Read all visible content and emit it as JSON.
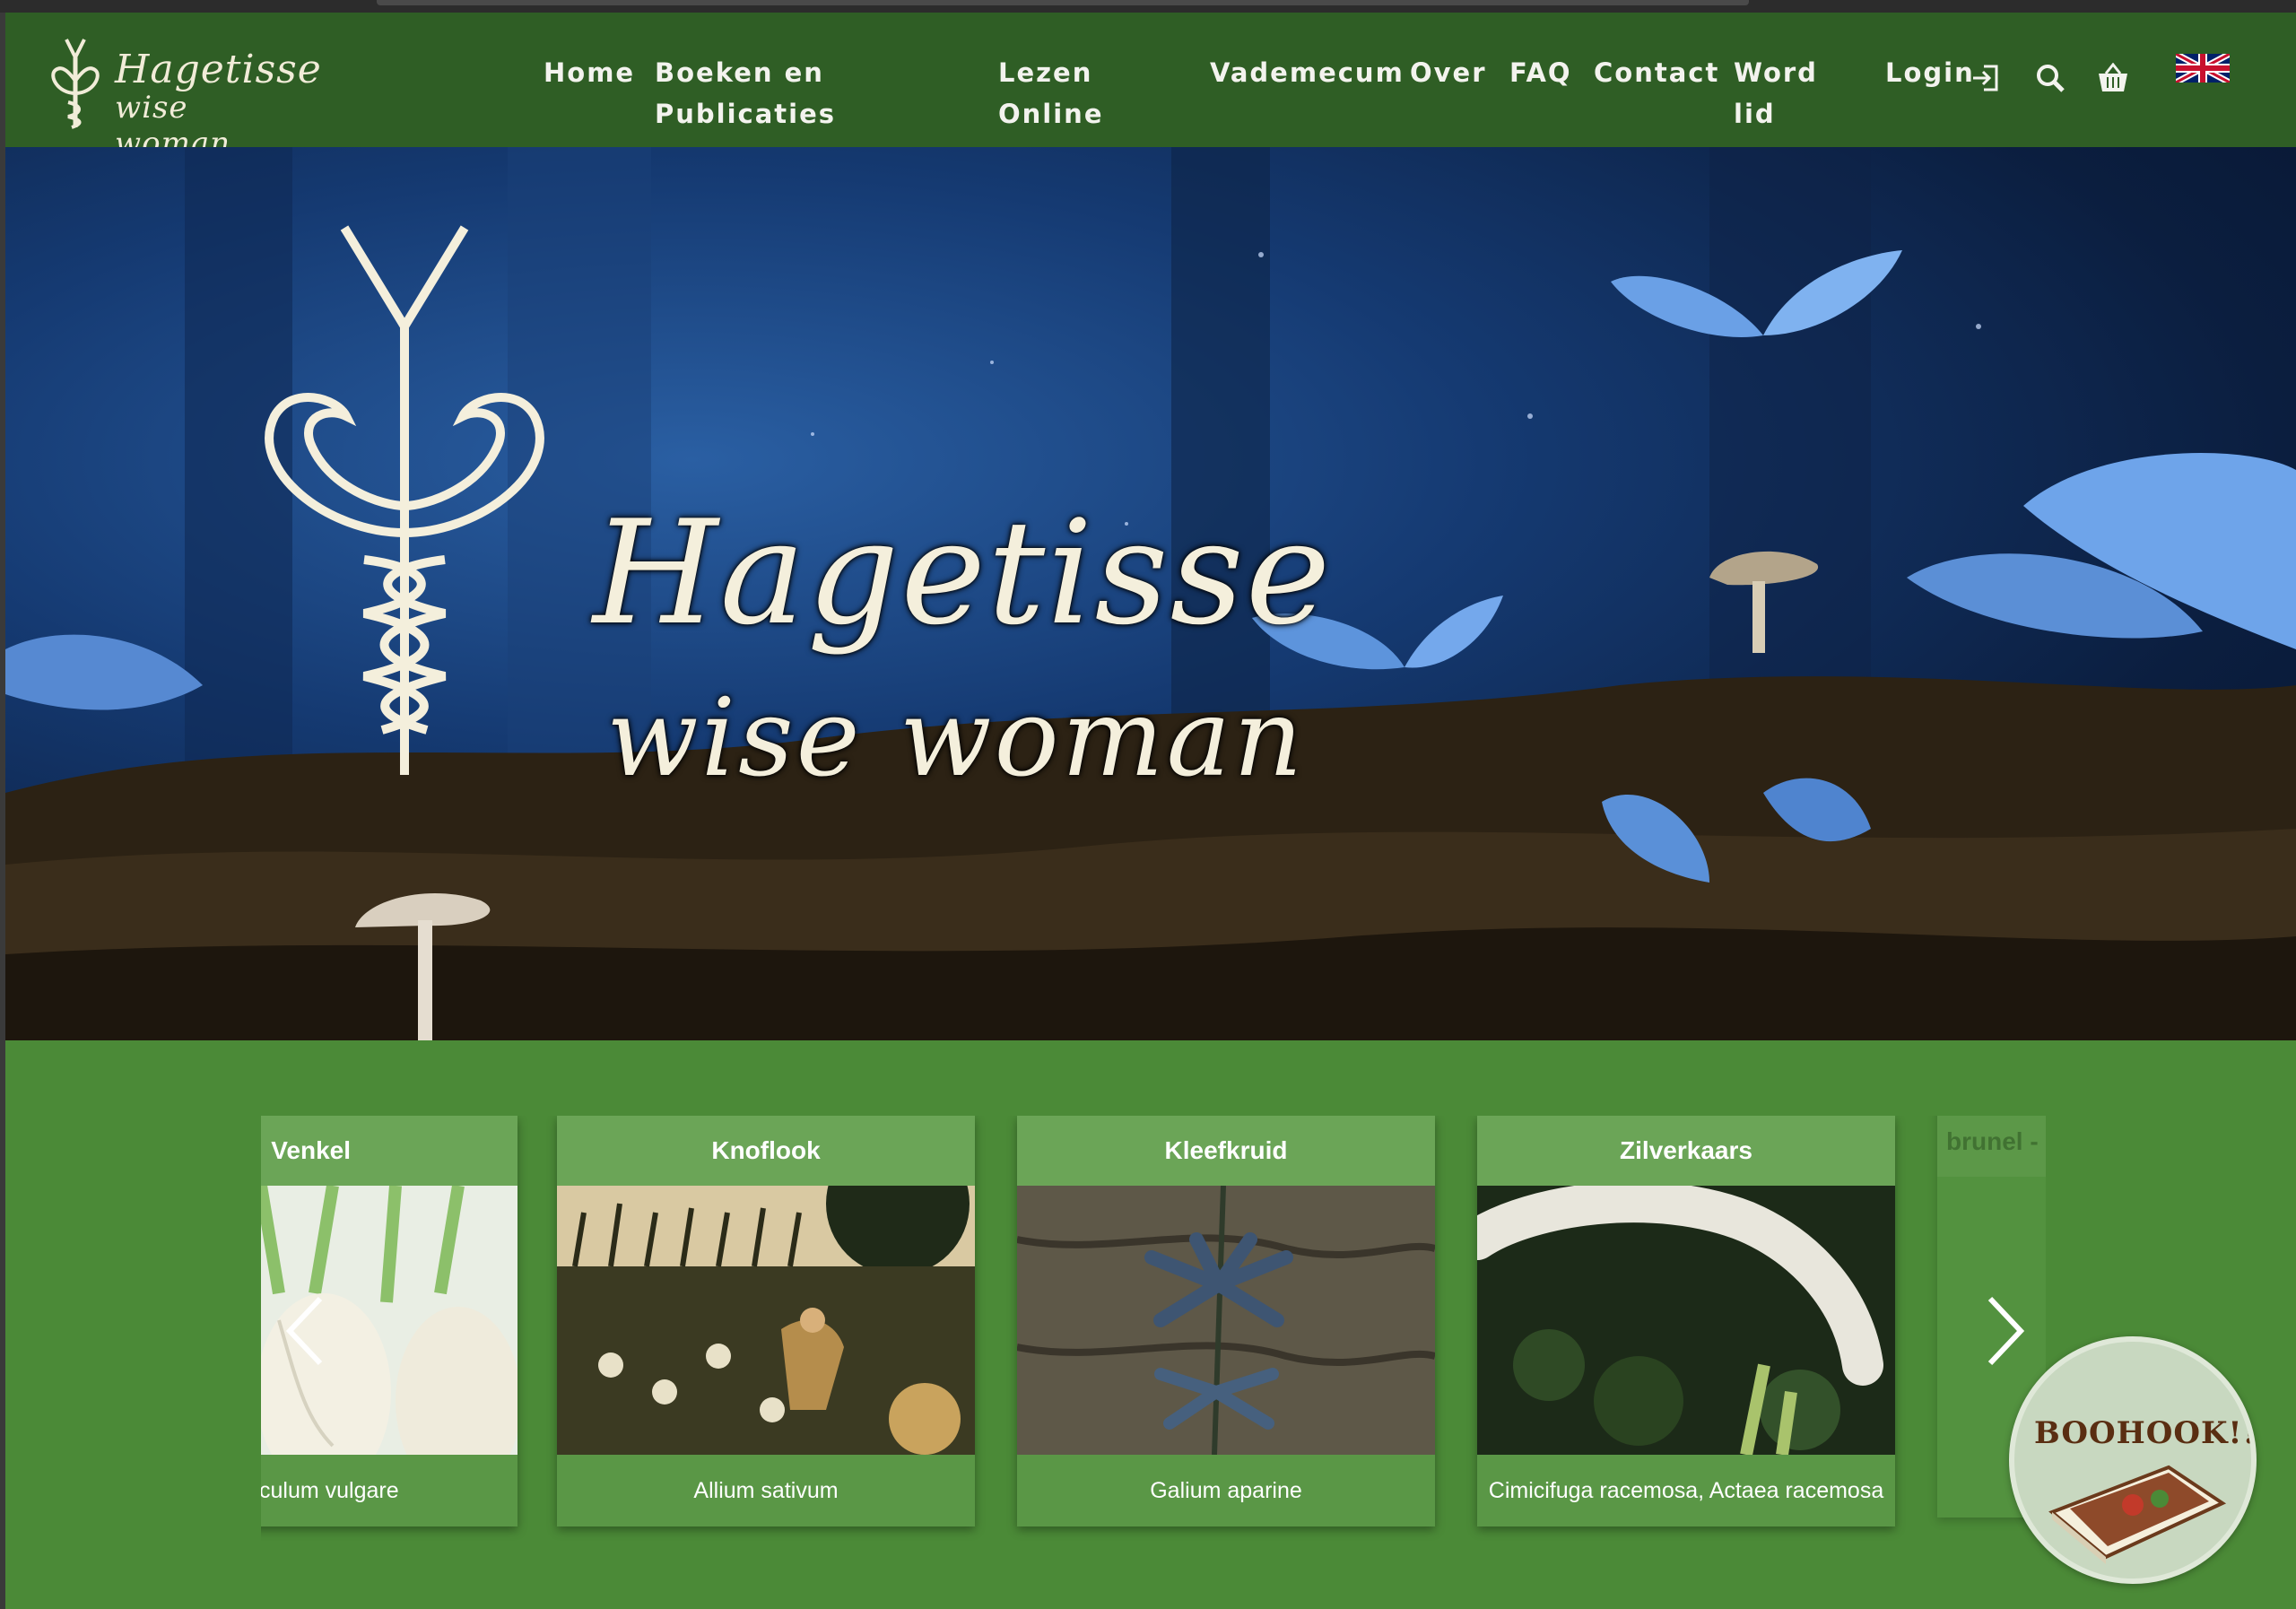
{
  "brand": {
    "line1": "Hagetisse",
    "line2": "wise woman"
  },
  "nav": {
    "home": "Home",
    "books_line1": "Boeken en",
    "books_line2": "Publicaties",
    "read_line1": "Lezen",
    "read_line2": "Online",
    "vademecum": "Vademecum",
    "over": "Over",
    "faq": "FAQ",
    "contact": "Contact",
    "member_line1": "Word",
    "member_line2": "lid",
    "login": "Login",
    "icons": [
      "login-icon",
      "search-icon",
      "basket-icon",
      "uk-flag-icon"
    ]
  },
  "hero": {
    "title_line1": "Hagetisse",
    "title_line2": "wise woman"
  },
  "carousel": {
    "cards": [
      {
        "title": "Venkel",
        "latin": "culum vulgare"
      },
      {
        "title": "Knoflook",
        "latin": "Allium sativum"
      },
      {
        "title": "Kleefkruid",
        "latin": "Galium aparine"
      },
      {
        "title": "Zilverkaars",
        "latin": "Cimicifuga racemosa, Actaea racemosa"
      },
      {
        "title": "brunel -",
        "latin": ""
      }
    ],
    "prev_icon": "chevron-left-icon",
    "next_icon": "chevron-right-icon"
  },
  "badge": {
    "text": "BOOHOOK!!"
  },
  "colors": {
    "nav": "#2f5e25",
    "page": "#4b8a37",
    "text": "#f3f3ee"
  }
}
